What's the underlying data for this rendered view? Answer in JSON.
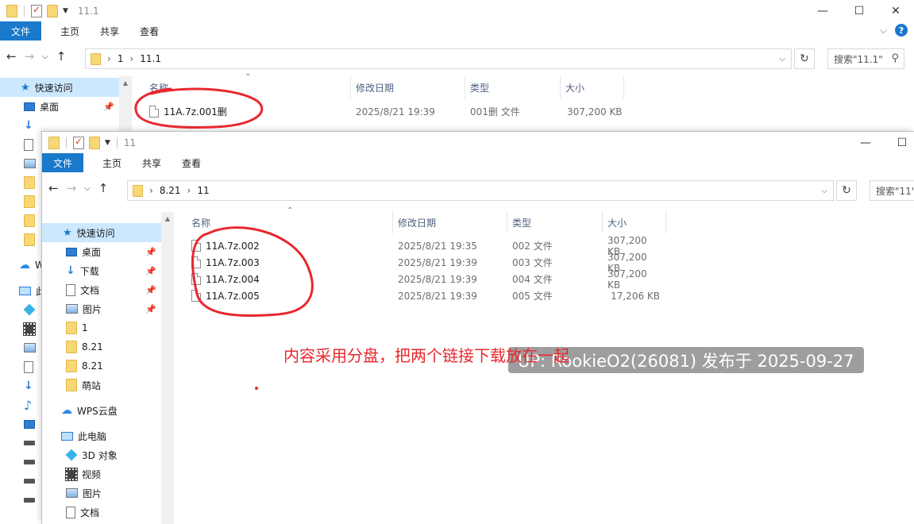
{
  "back_window": {
    "title": "11.1",
    "caption": [
      "—",
      "☐",
      "✕"
    ],
    "ribbon": {
      "file": "文件",
      "tabs": [
        "主页",
        "共享",
        "查看"
      ],
      "help": "?"
    },
    "breadcrumb": [
      "1",
      "11.1"
    ],
    "search_placeholder": "搜索\"11.1\"",
    "columns": [
      "名称",
      "修改日期",
      "类型",
      "大小"
    ],
    "files": [
      {
        "name": "11A.7z.001删",
        "date": "2025/8/21 19:39",
        "type": "001删 文件",
        "size": "307,200 KB"
      }
    ],
    "sidebar": {
      "quick_access": "快速访问",
      "desktop": "桌面",
      "wps_initial": "W",
      "pc_initial": "此"
    }
  },
  "front_window": {
    "title": "11",
    "caption": [
      "—",
      "☐"
    ],
    "ribbon": {
      "file": "文件",
      "tabs": [
        "主页",
        "共享",
        "查看"
      ]
    },
    "breadcrumb": [
      "8.21",
      "11"
    ],
    "search_placeholder": "搜索\"11\"",
    "columns": [
      "名称",
      "修改日期",
      "类型",
      "大小"
    ],
    "files": [
      {
        "name": "11A.7z.002",
        "date": "2025/8/21 19:35",
        "type": "002 文件",
        "size": "307,200 KB"
      },
      {
        "name": "11A.7z.003",
        "date": "2025/8/21 19:39",
        "type": "003 文件",
        "size": "307,200 KB"
      },
      {
        "name": "11A.7z.004",
        "date": "2025/8/21 19:39",
        "type": "004 文件",
        "size": "307,200 KB"
      },
      {
        "name": "11A.7z.005",
        "date": "2025/8/21 19:39",
        "type": "005 文件",
        "size": "17,206 KB"
      }
    ],
    "sidebar": {
      "quick_access": "快速访问",
      "pinned": [
        "桌面",
        "下载",
        "文档",
        "图片"
      ],
      "folders": [
        "1",
        "8.21",
        "8.21",
        "萌站"
      ],
      "wps": "WPS云盘",
      "this_pc": "此电脑",
      "pc_items": [
        "3D 对象",
        "视频",
        "图片",
        "文档"
      ]
    }
  },
  "annotation_text": "内容采用分盘，把两个链接下载放在一起",
  "watermark_text": "UP: RookieO2(26081) 发布于 2025-09-27",
  "colors": {
    "accent": "#1979ca",
    "annotation": "#e8282e",
    "selected": "#cce8ff"
  }
}
